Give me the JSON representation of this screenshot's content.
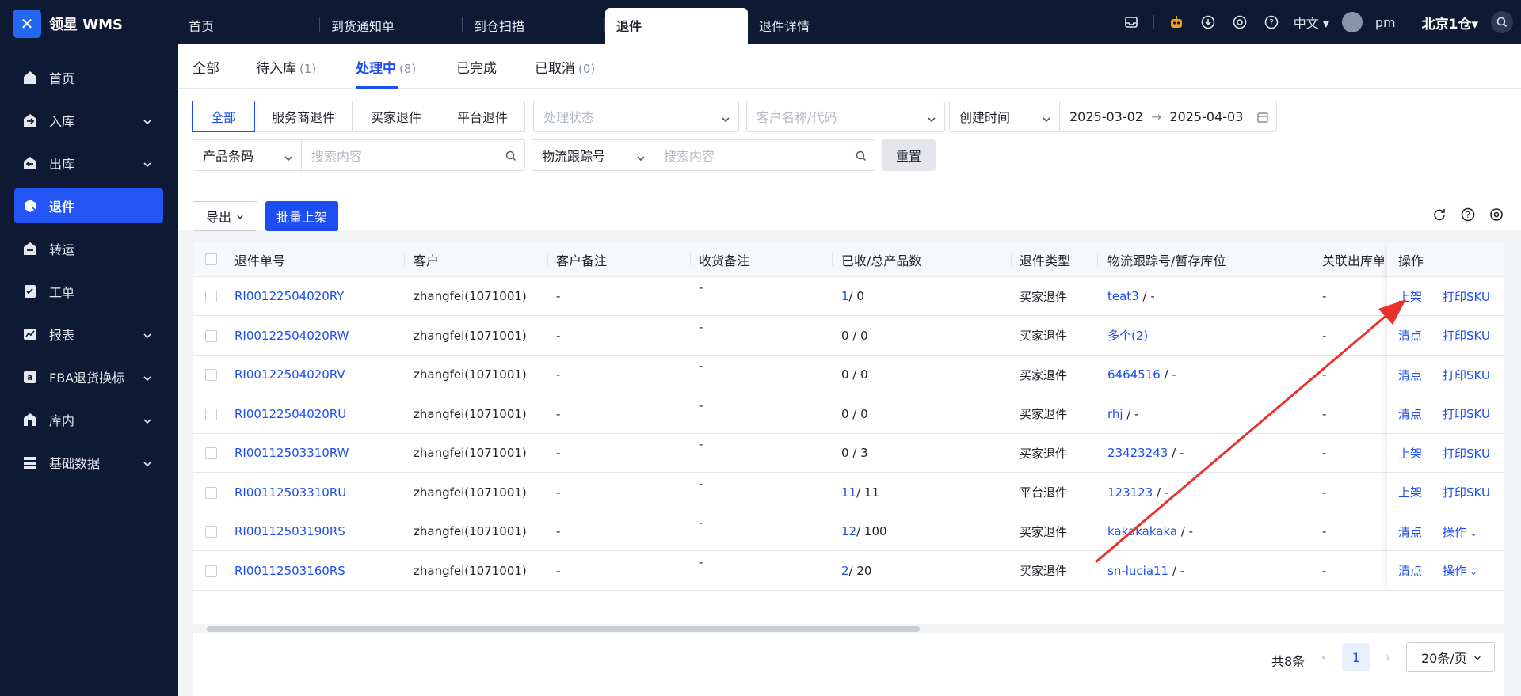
{
  "app": {
    "name": "领星 WMS"
  },
  "tabs": [
    "首页",
    "到货通知单",
    "到仓扫描",
    "退件",
    "退件详情"
  ],
  "top_right": {
    "lang": "中文",
    "user": "pm",
    "warehouse": "北京1仓"
  },
  "sidebar": {
    "items": [
      "首页",
      "入库",
      "出库",
      "退件",
      "转运",
      "工单",
      "报表",
      "FBA退货换标",
      "库内",
      "基础数据"
    ]
  },
  "status_tabs": [
    {
      "label": "全部",
      "count": ""
    },
    {
      "label": "待入库",
      "count": "(1)"
    },
    {
      "label": "处理中",
      "count": "(8)"
    },
    {
      "label": "已完成",
      "count": ""
    },
    {
      "label": "已取消",
      "count": "(0)"
    }
  ],
  "filters": {
    "types": [
      "全部",
      "服务商退件",
      "买家退件",
      "平台退件"
    ],
    "status_placeholder": "处理状态",
    "customer_placeholder": "客户名称/代码",
    "date_type": "创建时间",
    "date_start": "2025-03-02",
    "date_end": "2025-04-03",
    "product_field": "产品条码",
    "search_placeholder": "搜索内容",
    "tracking_field": "物流跟踪号",
    "reset": "重置"
  },
  "toolbar": {
    "export": "导出",
    "batch": "批量上架"
  },
  "table": {
    "headers": [
      "退件单号",
      "客户",
      "客户备注",
      "收货备注",
      "已收/总产品数",
      "退件类型",
      "物流跟踪号/暂存库位",
      "关联出库单号",
      "操作"
    ],
    "rows": [
      {
        "no": "RI00122504020RY",
        "customer": "zhangfei(1071001)",
        "cnote": "-",
        "rnote": "-",
        "recv": "1",
        "total": "/ 0",
        "type": "买家退件",
        "track": "teat3",
        "loc": " / -",
        "rel": "-",
        "op1": "上架",
        "op2": "打印SKU"
      },
      {
        "no": "RI00122504020RW",
        "customer": "zhangfei(1071001)",
        "cnote": "-",
        "rnote": "-",
        "recv": "",
        "total": "0 / 0",
        "type": "买家退件",
        "track": "多个(2)",
        "loc": "",
        "rel": "-",
        "op1": "清点",
        "op2": "打印SKU"
      },
      {
        "no": "RI00122504020RV",
        "customer": "zhangfei(1071001)",
        "cnote": "-",
        "rnote": "-",
        "recv": "",
        "total": "0 / 0",
        "type": "买家退件",
        "track": "6464516",
        "loc": " / -",
        "rel": "-",
        "op1": "清点",
        "op2": "打印SKU"
      },
      {
        "no": "RI00122504020RU",
        "customer": "zhangfei(1071001)",
        "cnote": "-",
        "rnote": "-",
        "recv": "",
        "total": "0 / 0",
        "type": "买家退件",
        "track": "rhj",
        "loc": " / -",
        "rel": "-",
        "op1": "清点",
        "op2": "打印SKU"
      },
      {
        "no": "RI00112503310RW",
        "customer": "zhangfei(1071001)",
        "cnote": "-",
        "rnote": "-",
        "recv": "",
        "total": "0 / 3",
        "type": "买家退件",
        "track": "23423243",
        "loc": " / -",
        "rel": "-",
        "op1": "上架",
        "op2": "打印SKU"
      },
      {
        "no": "RI00112503310RU",
        "customer": "zhangfei(1071001)",
        "cnote": "-",
        "rnote": "-",
        "recv": "11",
        "total": "/ 11",
        "type": "平台退件",
        "track": "123123",
        "loc": " / -",
        "rel": "-",
        "op1": "上架",
        "op2": "打印SKU"
      },
      {
        "no": "RI00112503190RS",
        "customer": "zhangfei(1071001)",
        "cnote": "-",
        "rnote": "-",
        "recv": "12",
        "total": "/ 100",
        "type": "买家退件",
        "track": "kakakakaka",
        "loc": " / -",
        "rel": "-",
        "op1": "清点",
        "op2": "操作"
      },
      {
        "no": "RI00112503160RS",
        "customer": "zhangfei(1071001)",
        "cnote": "-",
        "rnote": "-",
        "recv": "2",
        "total": "/ 20",
        "type": "买家退件",
        "track": "sn-lucia11",
        "loc": " / -",
        "rel": "-",
        "op1": "清点",
        "op2": "操作"
      }
    ]
  },
  "pager": {
    "total": "共8条",
    "current": "1",
    "size": "20条/页"
  },
  "colors": {
    "nav_bg": "#0e1a33",
    "accent": "#1d4ef2",
    "arrow": "#e8322b"
  }
}
